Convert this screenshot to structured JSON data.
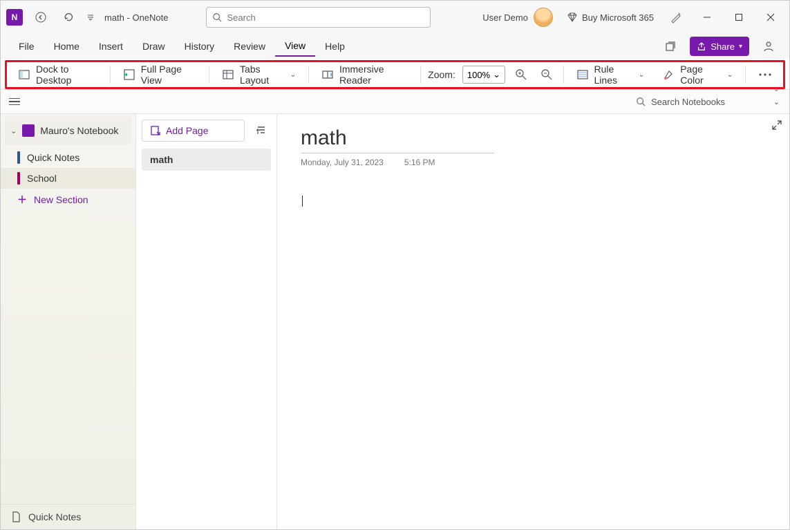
{
  "titlebar": {
    "doc_title": "math  -  OneNote",
    "search_placeholder": "Search",
    "user_label": "User Demo",
    "buy365_label": "Buy Microsoft 365"
  },
  "menubar": {
    "items": [
      "File",
      "Home",
      "Insert",
      "Draw",
      "History",
      "Review",
      "View",
      "Help"
    ],
    "active_index": 6,
    "share_label": "Share"
  },
  "ribbon": {
    "dock_label": "Dock to Desktop",
    "fullpage_label": "Full Page View",
    "tabs_layout_label": "Tabs Layout",
    "immersive_label": "Immersive Reader",
    "zoom_label": "Zoom:",
    "zoom_value": "100%",
    "rule_lines_label": "Rule Lines",
    "page_color_label": "Page Color"
  },
  "search_row": {
    "search_notebooks_label": "Search Notebooks"
  },
  "sidebar": {
    "notebook_name": "Mauro's Notebook",
    "sections": [
      {
        "label": "Quick Notes",
        "color": "#2b579a",
        "selected": false
      },
      {
        "label": "School",
        "color": "#a4005b",
        "selected": true
      }
    ],
    "new_section_label": "New Section",
    "footer_label": "Quick Notes"
  },
  "pagelist": {
    "add_page_label": "Add Page",
    "pages": [
      {
        "label": "math",
        "selected": true
      }
    ]
  },
  "canvas": {
    "page_title": "math",
    "date": "Monday, July 31, 2023",
    "time": "5:16 PM"
  }
}
